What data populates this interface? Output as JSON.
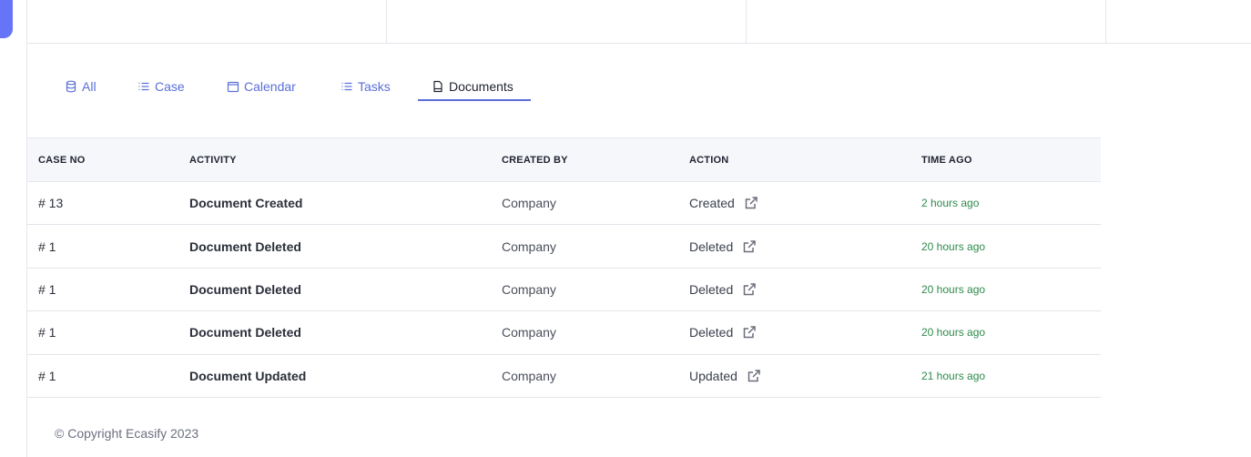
{
  "tabs": [
    {
      "label": "All",
      "icon": "database-icon"
    },
    {
      "label": "Case",
      "icon": "list-icon"
    },
    {
      "label": "Calendar",
      "icon": "calendar-icon"
    },
    {
      "label": "Tasks",
      "icon": "list-icon"
    },
    {
      "label": "Documents",
      "icon": "document-icon",
      "active": true
    }
  ],
  "table": {
    "headers": {
      "case_no": "CASE NO",
      "activity": "ACTIVITY",
      "created_by": "CREATED BY",
      "action": "ACTION",
      "time_ago": "TIME AGO"
    },
    "rows": [
      {
        "case_no": "# 13",
        "activity": "Document Created",
        "created_by": "Company",
        "action": "Created",
        "time_ago": "2 hours ago"
      },
      {
        "case_no": "# 1",
        "activity": "Document Deleted",
        "created_by": "Company",
        "action": "Deleted",
        "time_ago": "20 hours ago"
      },
      {
        "case_no": "# 1",
        "activity": "Document Deleted",
        "created_by": "Company",
        "action": "Deleted",
        "time_ago": "20 hours ago"
      },
      {
        "case_no": "# 1",
        "activity": "Document Deleted",
        "created_by": "Company",
        "action": "Deleted",
        "time_ago": "20 hours ago"
      },
      {
        "case_no": "# 1",
        "activity": "Document Updated",
        "created_by": "Company",
        "action": "Updated",
        "time_ago": "21 hours ago"
      }
    ]
  },
  "footer": {
    "copyright": "© Copyright Ecasify 2023"
  },
  "colors": {
    "accent": "#5a6fd8",
    "time_green": "#2e8b4b",
    "header_bg": "#f6f7fb"
  }
}
